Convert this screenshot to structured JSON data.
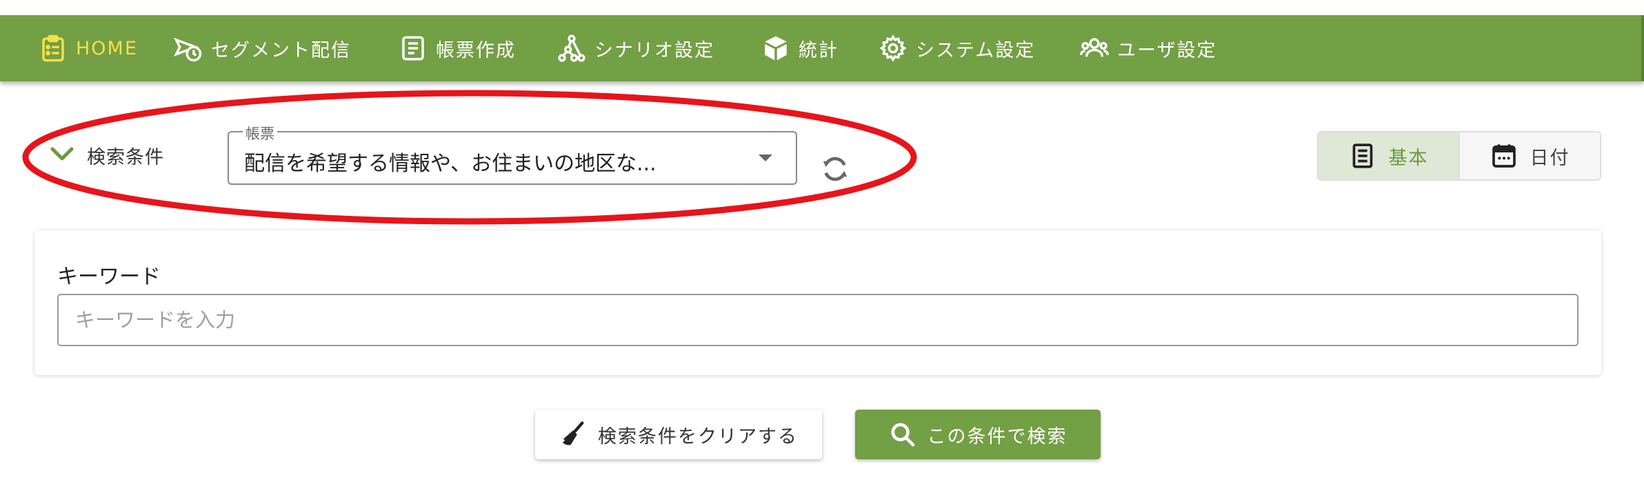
{
  "colors": {
    "primary": "#739f45",
    "active_nav": "#f4e04a",
    "highlight": "#e8141b",
    "toggle_active_bg": "#dfe8d7"
  },
  "nav": {
    "items": [
      {
        "label": "HOME",
        "icon": "clipboard-list-icon",
        "active": true
      },
      {
        "label": "セグメント配信",
        "icon": "send-clock-icon"
      },
      {
        "label": "帳票作成",
        "icon": "document-lines-icon"
      },
      {
        "label": "シナリオ設定",
        "icon": "scenario-graph-icon"
      },
      {
        "label": "統計",
        "icon": "cube-icon"
      },
      {
        "label": "システム設定",
        "icon": "gear-icon"
      },
      {
        "label": "ユーザ設定",
        "icon": "users-icon"
      }
    ]
  },
  "search": {
    "toggle_label": "検索条件",
    "form_select": {
      "legend": "帳票",
      "value": "配信を希望する情報や、お住まいの地区な..."
    },
    "mode_toggle": {
      "basic_label": "基本",
      "date_label": "日付",
      "selected": "基本"
    },
    "keyword": {
      "label": "キーワード",
      "placeholder": "キーワードを入力",
      "value": ""
    },
    "clear_button": "検索条件をクリアする",
    "search_button": "この条件で検索"
  }
}
